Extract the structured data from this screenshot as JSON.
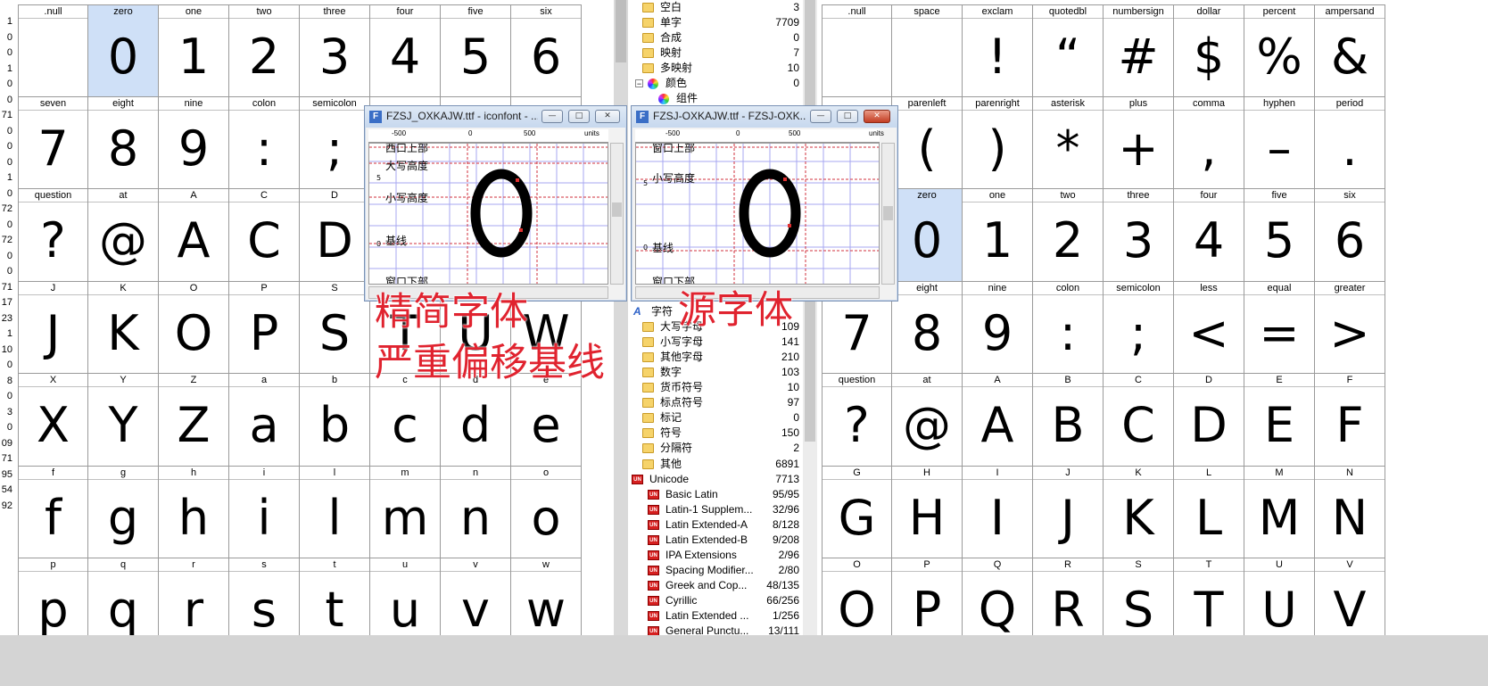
{
  "left_column_numbers": [
    "1",
    "0",
    "0",
    "1",
    "0",
    "0",
    "71",
    "0",
    "0",
    "0",
    "1",
    "0",
    "72",
    "0",
    "72",
    "0",
    "0",
    "71",
    "17",
    "23",
    "1",
    "10",
    "0",
    "8",
    "0",
    "3",
    "0",
    "09",
    "71",
    "95",
    "54",
    "92"
  ],
  "left_grid": {
    "rows": [
      {
        "labels": [
          ".null",
          "zero",
          "one",
          "two",
          "three",
          "four",
          "five",
          "six"
        ],
        "glyphs": [
          "",
          "0",
          "1",
          "2",
          "3",
          "4",
          "5",
          "6"
        ]
      },
      {
        "labels": [
          "seven",
          "eight",
          "nine",
          "colon",
          "semicolon",
          "",
          "",
          ""
        ],
        "glyphs": [
          "7",
          "8",
          "9",
          ":",
          ";",
          "",
          "",
          ""
        ]
      },
      {
        "labels": [
          "question",
          "at",
          "A",
          "C",
          "D",
          "",
          "",
          ""
        ],
        "glyphs": [
          "?",
          "@",
          "A",
          "C",
          "D",
          "",
          "",
          ""
        ]
      },
      {
        "labels": [
          "J",
          "K",
          "O",
          "P",
          "S",
          "",
          "",
          ""
        ],
        "glyphs": [
          "J",
          "K",
          "O",
          "P",
          "S",
          "T",
          "U",
          "W"
        ]
      },
      {
        "labels": [
          "X",
          "Y",
          "Z",
          "a",
          "b",
          "c",
          "d",
          "e"
        ],
        "glyphs": [
          "X",
          "Y",
          "Z",
          "a",
          "b",
          "c",
          "d",
          "e"
        ]
      },
      {
        "labels": [
          "f",
          "g",
          "h",
          "i",
          "l",
          "m",
          "n",
          "o"
        ],
        "glyphs": [
          "f",
          "g",
          "h",
          "i",
          "l",
          "m",
          "n",
          "o"
        ]
      },
      {
        "labels": [
          "p",
          "q",
          "r",
          "s",
          "t",
          "u",
          "v",
          "w"
        ],
        "glyphs": [
          "p",
          "q",
          "r",
          "s",
          "t",
          "u",
          "v",
          "w"
        ]
      }
    ]
  },
  "right_grid": {
    "rows": [
      {
        "labels": [
          ".null",
          "space",
          "exclam",
          "quotedbl",
          "numbersign",
          "dollar",
          "percent",
          "ampersand"
        ],
        "glyphs": [
          "",
          "",
          "!",
          "“",
          "#",
          "$",
          "%",
          "&"
        ]
      },
      {
        "labels": [
          "",
          "parenleft",
          "parenright",
          "asterisk",
          "plus",
          "comma",
          "hyphen",
          "period"
        ],
        "glyphs": [
          "",
          "(",
          ")",
          "*",
          "+",
          ",",
          "–",
          "."
        ]
      },
      {
        "labels": [
          "",
          "zero",
          "one",
          "two",
          "three",
          "four",
          "five",
          "six"
        ],
        "glyphs": [
          "",
          "0",
          "1",
          "2",
          "3",
          "4",
          "5",
          "6"
        ]
      },
      {
        "labels": [
          "",
          "eight",
          "nine",
          "colon",
          "semicolon",
          "less",
          "equal",
          "greater"
        ],
        "glyphs": [
          "7",
          "8",
          "9",
          ":",
          ";",
          "<",
          "=",
          ">"
        ]
      },
      {
        "labels": [
          "question",
          "at",
          "A",
          "B",
          "C",
          "D",
          "E",
          "F"
        ],
        "glyphs": [
          "?",
          "@",
          "A",
          "B",
          "C",
          "D",
          "E",
          "F"
        ]
      },
      {
        "labels": [
          "G",
          "H",
          "I",
          "J",
          "K",
          "L",
          "M",
          "N"
        ],
        "glyphs": [
          "G",
          "H",
          "I",
          "J",
          "K",
          "L",
          "M",
          "N"
        ]
      },
      {
        "labels": [
          "O",
          "P",
          "Q",
          "R",
          "S",
          "T",
          "U",
          "V"
        ],
        "glyphs": [
          "O",
          "P",
          "Q",
          "R",
          "S",
          "T",
          "U",
          "V"
        ]
      }
    ]
  },
  "tree": [
    {
      "kind": "folder",
      "label": "空白",
      "count": "3"
    },
    {
      "kind": "folder",
      "label": "单字",
      "count": "7709"
    },
    {
      "kind": "folder",
      "label": "合成",
      "count": "0"
    },
    {
      "kind": "folder",
      "label": "映射",
      "count": "7"
    },
    {
      "kind": "folder",
      "label": "多映射",
      "count": "10"
    },
    {
      "kind": "color",
      "label": "颜色",
      "count": "0"
    },
    {
      "kind": "color",
      "label": "组件",
      "count": ""
    },
    {
      "kind": "hidden",
      "label": "",
      "count": ""
    },
    {
      "kind": "hidden",
      "label": "",
      "count": ""
    },
    {
      "kind": "hidden",
      "label": "",
      "count": ""
    },
    {
      "kind": "hidden",
      "label": "",
      "count": ""
    },
    {
      "kind": "hidden",
      "label": "",
      "count": ""
    },
    {
      "kind": "hidden",
      "label": "",
      "count": ""
    },
    {
      "kind": "hidden",
      "label": "",
      "count": ""
    },
    {
      "kind": "hidden",
      "label": "",
      "count": ""
    },
    {
      "kind": "hidden",
      "label": "",
      "count": ""
    },
    {
      "kind": "hidden",
      "label": "",
      "count": ""
    },
    {
      "kind": "hidden",
      "label": "",
      "count": ""
    },
    {
      "kind": "hidden",
      "label": "",
      "count": ""
    },
    {
      "kind": "hidden",
      "label": "",
      "count": ""
    },
    {
      "kind": "font",
      "label": "字符",
      "count": ""
    },
    {
      "kind": "folder",
      "label": "大写字母",
      "count": "109"
    },
    {
      "kind": "folder",
      "label": "小写字母",
      "count": "141"
    },
    {
      "kind": "folder",
      "label": "其他字母",
      "count": "210"
    },
    {
      "kind": "folder",
      "label": "数字",
      "count": "103"
    },
    {
      "kind": "folder",
      "label": "货币符号",
      "count": "10"
    },
    {
      "kind": "folder",
      "label": "标点符号",
      "count": "97"
    },
    {
      "kind": "folder",
      "label": "标记",
      "count": "0"
    },
    {
      "kind": "folder",
      "label": "符号",
      "count": "150"
    },
    {
      "kind": "folder",
      "label": "分隔符",
      "count": "2"
    },
    {
      "kind": "folder",
      "label": "其他",
      "count": "6891"
    },
    {
      "kind": "unicode-root",
      "label": "Unicode",
      "count": "7713"
    },
    {
      "kind": "unicode",
      "label": "Basic Latin",
      "count": "95/95"
    },
    {
      "kind": "unicode",
      "label": "Latin-1 Supplem...",
      "count": "32/96"
    },
    {
      "kind": "unicode",
      "label": "Latin Extended-A",
      "count": "8/128"
    },
    {
      "kind": "unicode",
      "label": "Latin Extended-B",
      "count": "9/208"
    },
    {
      "kind": "unicode",
      "label": "IPA Extensions",
      "count": "2/96"
    },
    {
      "kind": "unicode",
      "label": "Spacing Modifier...",
      "count": "2/80"
    },
    {
      "kind": "unicode",
      "label": "Greek and Cop...",
      "count": "48/135"
    },
    {
      "kind": "unicode",
      "label": "Cyrillic",
      "count": "66/256"
    },
    {
      "kind": "unicode",
      "label": "Latin Extended ...",
      "count": "1/256"
    },
    {
      "kind": "unicode",
      "label": "General Punctu...",
      "count": "13/111"
    }
  ],
  "win_left": {
    "title": "FZSJ_OXKAJW.ttf - iconfont - ...",
    "ruler": [
      "-500",
      "0",
      "500",
      "units"
    ],
    "vruler": [
      "5",
      "0",
      "0"
    ],
    "levels": [
      "西口上部",
      "大写高度",
      "小写高度",
      "基线",
      "窗口下部"
    ],
    "glyph": "0"
  },
  "win_right": {
    "title": "FZSJ-OXKAJW.ttf - FZSJ-OXK...",
    "ruler": [
      "-500",
      "0",
      "500",
      "units"
    ],
    "vruler": [
      "5",
      "0",
      "0"
    ],
    "levels": [
      "窗口上部",
      "小写高度",
      "基线",
      "窗口下部"
    ],
    "glyph": "0"
  },
  "window_controls": {
    "minimize": "—",
    "maximize": "□",
    "close": "✕"
  },
  "annotation": {
    "left_line1": "精简字体",
    "left_line2": "严重偏移基线",
    "right_line1": "源字体"
  },
  "colors": {
    "selected": "#cfe0f7",
    "annotation": "#e0232f",
    "grid_line": "#9a9a9a"
  }
}
